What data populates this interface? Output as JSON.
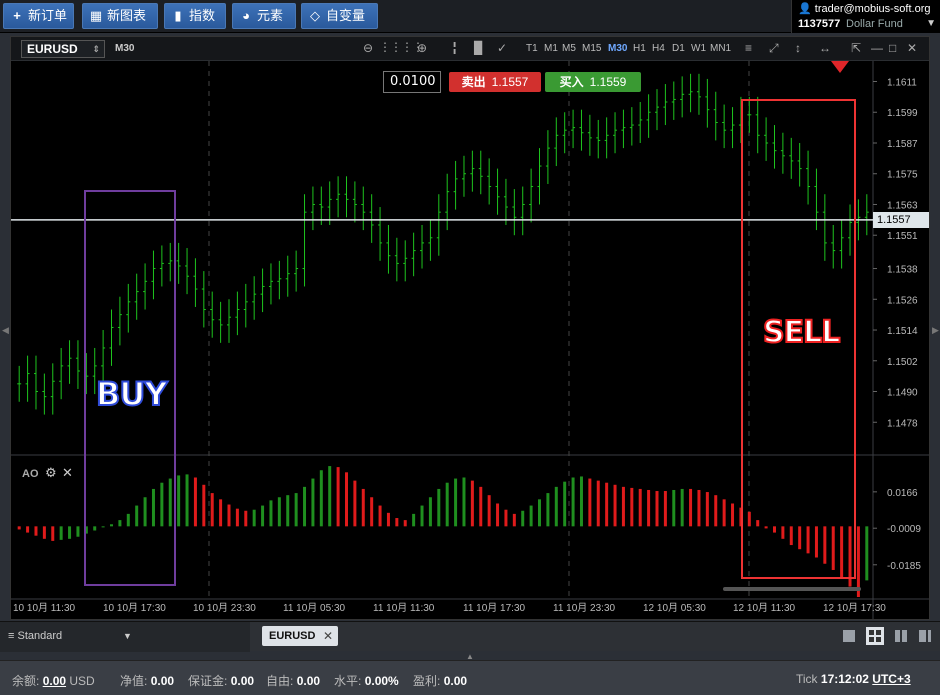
{
  "toolbar": {
    "buttons": [
      {
        "icon": "+",
        "label": "新订单"
      },
      {
        "icon": "▦",
        "label": "新图表"
      },
      {
        "icon": "▮",
        "label": "指数"
      },
      {
        "icon": "◕",
        "label": "元素"
      },
      {
        "icon": "◇",
        "label": "自变量"
      }
    ]
  },
  "account": {
    "user": "trader@mobius-soft.org",
    "id": "1137577",
    "fund": "Dollar Fund"
  },
  "chart": {
    "symbol": "EURUSD",
    "timeframe": "M30",
    "timeframes": [
      "T1",
      "M1",
      "M5",
      "M15",
      "M30",
      "H1",
      "H4",
      "D1",
      "W1",
      "MN1"
    ],
    "active_timeframe": "M30",
    "step": "0.0100",
    "sell_label": "卖出",
    "sell_price": "1.1557",
    "buy_label": "买入",
    "buy_price": "1.1559",
    "current_price": "1.1557",
    "annotation_buy": "BUY",
    "annotation_sell": "SELL",
    "indicator_label": "AO",
    "colors": {
      "up": "#1ec41e",
      "ao_up": "#1f8f1f",
      "ao_down": "#e01b1b",
      "sell": "#d2302e",
      "buy": "#3a9a33"
    }
  },
  "chart_data": {
    "type": "bar",
    "price_axis_ticks": [
      "1.1611",
      "1.1599",
      "1.1587",
      "1.1575",
      "1.1563",
      "1.1551",
      "1.1538",
      "1.1526",
      "1.1514",
      "1.1502",
      "1.1490",
      "1.1478"
    ],
    "ao_axis_ticks": [
      "0.0166",
      "-0.0009",
      "-0.0185"
    ],
    "time_ticks": [
      "10 10月 11:30",
      "10 10月 17:30",
      "10 10月 23:30",
      "11 10月 05:30",
      "11 10月 11:30",
      "11 10月 17:30",
      "11 10月 23:30",
      "12 10月 05:30",
      "12 10月 11:30",
      "12 10月 17:30"
    ],
    "ylim": [
      1.1466,
      1.1619
    ],
    "price_closes": [
      1.1493,
      1.1497,
      1.149,
      1.1488,
      1.1494,
      1.15,
      1.1503,
      1.1498,
      1.1496,
      1.15,
      1.1507,
      1.1515,
      1.152,
      1.1525,
      1.1529,
      1.1533,
      1.1538,
      1.154,
      1.1541,
      1.1539,
      1.1535,
      1.153,
      1.1522,
      1.1518,
      1.1516,
      1.1519,
      1.1522,
      1.1525,
      1.1528,
      1.1531,
      1.1533,
      1.1534,
      1.1536,
      1.1538,
      1.156,
      1.1563,
      1.1562,
      1.1565,
      1.1567,
      1.1565,
      1.1563,
      1.156,
      1.1555,
      1.1548,
      1.1543,
      1.154,
      1.1542,
      1.1545,
      1.1548,
      1.155,
      1.156,
      1.1568,
      1.1573,
      1.1575,
      1.1577,
      1.1574,
      1.157,
      1.1566,
      1.1562,
      1.1558,
      1.1563,
      1.157,
      1.1578,
      1.1585,
      1.159,
      1.1592,
      1.1593,
      1.1591,
      1.1589,
      1.1588,
      1.159,
      1.1592,
      1.1593,
      1.1594,
      1.1596,
      1.1599,
      1.1601,
      1.1603,
      1.1604,
      1.1606,
      1.1607,
      1.1605,
      1.16,
      1.1595,
      1.1592,
      1.1594,
      1.1598,
      1.1598,
      1.159,
      1.1587,
      1.1584,
      1.1582,
      1.158,
      1.1577,
      1.157,
      1.156,
      1.1548,
      1.1545,
      1.155,
      1.1556,
      1.1558,
      1.156
    ],
    "ao_values": [
      -0.0015,
      -0.003,
      -0.0045,
      -0.006,
      -0.007,
      -0.0065,
      -0.006,
      -0.005,
      -0.0035,
      -0.002,
      -0.0005,
      0.001,
      0.003,
      0.006,
      0.01,
      0.014,
      0.018,
      0.021,
      0.023,
      0.0245,
      0.025,
      0.0235,
      0.02,
      0.016,
      0.013,
      0.0105,
      0.0085,
      0.0075,
      0.008,
      0.01,
      0.0125,
      0.014,
      0.015,
      0.016,
      0.019,
      0.023,
      0.027,
      0.029,
      0.0285,
      0.026,
      0.022,
      0.018,
      0.014,
      0.01,
      0.0065,
      0.004,
      0.003,
      0.006,
      0.01,
      0.014,
      0.018,
      0.021,
      0.023,
      0.0235,
      0.022,
      0.019,
      0.015,
      0.011,
      0.008,
      0.006,
      0.0075,
      0.01,
      0.013,
      0.016,
      0.019,
      0.0215,
      0.0235,
      0.024,
      0.023,
      0.022,
      0.021,
      0.02,
      0.019,
      0.0185,
      0.018,
      0.0175,
      0.017,
      0.017,
      0.0175,
      0.018,
      0.018,
      0.0175,
      0.0165,
      0.015,
      0.013,
      0.011,
      0.009,
      0.007,
      0.003,
      -0.001,
      -0.003,
      -0.006,
      -0.009,
      -0.011,
      -0.013,
      -0.015,
      -0.018,
      -0.021,
      -0.025,
      -0.029,
      -0.034,
      -0.026
    ]
  },
  "tabs": {
    "workspace": "Standard",
    "chart_tab": "EURUSD"
  },
  "status": {
    "balance_label": "余额:",
    "balance_value": "0.00",
    "currency": "USD",
    "equity_label": "净值:",
    "equity_value": "0.00",
    "margin_label": "保证金:",
    "margin_value": "0.00",
    "free_label": "自由:",
    "free_value": "0.00",
    "level_label": "水平:",
    "level_value": "0.00%",
    "profit_label": "盈利:",
    "profit_value": "0.00",
    "tick_label": "Tick",
    "time": "17:12:02",
    "timezone": "UTC+3"
  }
}
